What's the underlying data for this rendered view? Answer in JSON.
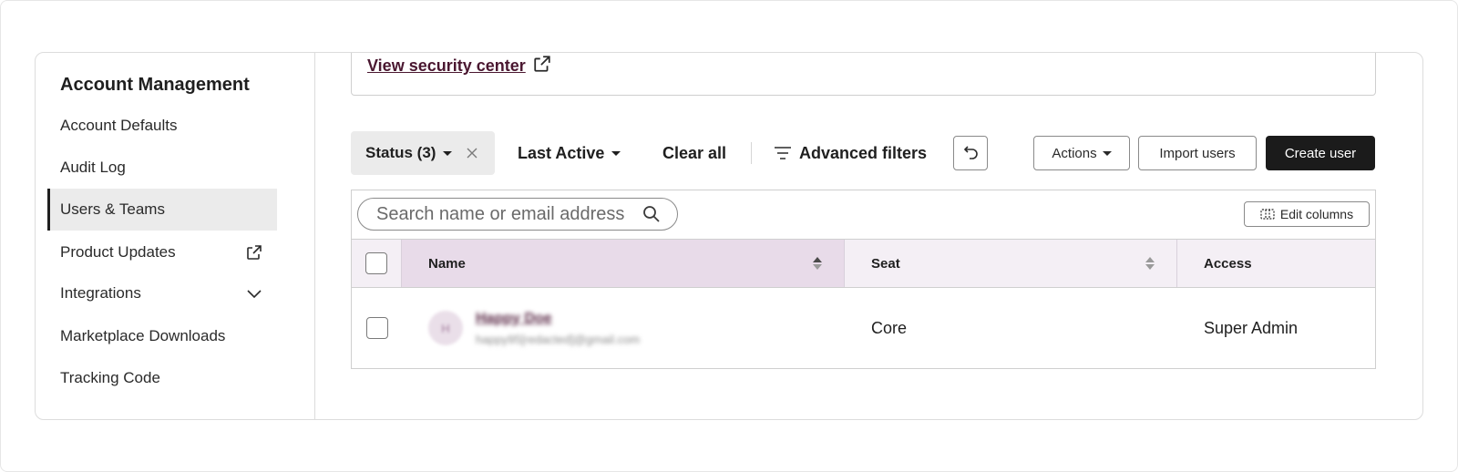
{
  "sidebar": {
    "title": "Account Management",
    "items": [
      {
        "label": "Account Defaults",
        "active": false
      },
      {
        "label": "Audit Log",
        "active": false
      },
      {
        "label": "Users & Teams",
        "active": true
      },
      {
        "label": "Product Updates",
        "active": false,
        "trailing_icon": "external-link-icon"
      },
      {
        "label": "Integrations",
        "active": false,
        "trailing_icon": "chevron-down-icon"
      },
      {
        "label": "Marketplace Downloads",
        "active": false
      },
      {
        "label": "Tracking Code",
        "active": false
      }
    ]
  },
  "security": {
    "link_label": "View security center",
    "link_icon": "external-link-icon"
  },
  "filters": {
    "status_label": "Status (3)",
    "last_active_label": "Last Active",
    "clear_all_label": "Clear all",
    "advanced_label": "Advanced filters",
    "undo_icon": "undo-icon"
  },
  "toolbar": {
    "actions_label": "Actions",
    "import_label": "Import users",
    "create_label": "Create user"
  },
  "table": {
    "search_placeholder": "Search name or email address",
    "edit_columns_label": "Edit columns",
    "columns": {
      "name": "Name",
      "seat": "Seat",
      "access": "Access"
    },
    "rows": [
      {
        "avatar_initials": "H",
        "name": "Happy Doe",
        "email": "happy95[redacted]@gmail.com",
        "seat": "Core",
        "access": "Super Admin"
      }
    ]
  },
  "colors": {
    "accent_link": "#4a1730",
    "header_bg": "#f4eff5",
    "sorted_header_bg": "#e8dbe9",
    "primary_button": "#1b1b1b"
  }
}
